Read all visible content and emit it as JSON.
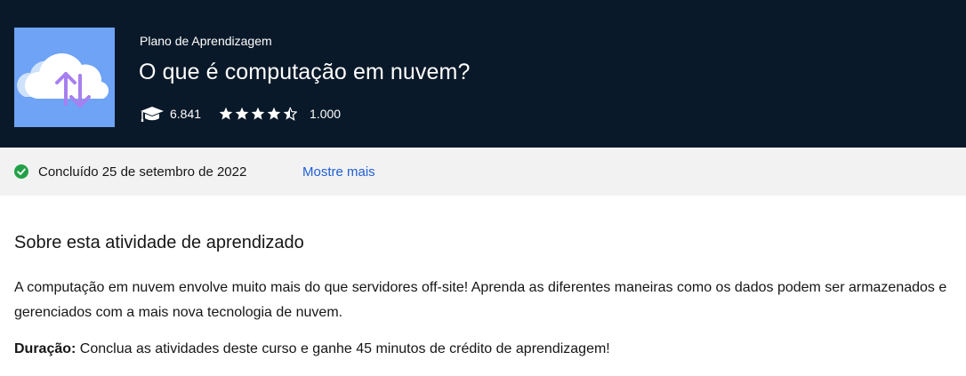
{
  "header": {
    "kicker": "Plano de Aprendizagem",
    "title": "O que é computação em nuvem?",
    "learners_count": "6.841",
    "rating_stars": 4.5,
    "ratings_count": "1.000",
    "thumbnail_icon": "cloud-sync-icon",
    "colors": {
      "background": "#0a1929",
      "thumbnail": "#6ea3f5",
      "arrows": "#a77ff0"
    }
  },
  "status": {
    "icon": "check-circle-icon",
    "text": "Concluído 25 de setembro de 2022",
    "more_link": "Mostre mais",
    "colors": {
      "check": "#24a148",
      "link": "#1f5fd6"
    }
  },
  "about": {
    "heading": "Sobre esta atividade de aprendizado",
    "description": "A computação em nuvem envolve muito mais do que servidores off-site! Aprenda as diferentes maneiras como os dados podem ser armazenados e gerenciados com a mais nova tecnologia de nuvem.",
    "duration_label": "Duração:",
    "duration_text": " Conclua as atividades deste curso e ganhe 45 minutos de crédito de aprendizagem!"
  }
}
